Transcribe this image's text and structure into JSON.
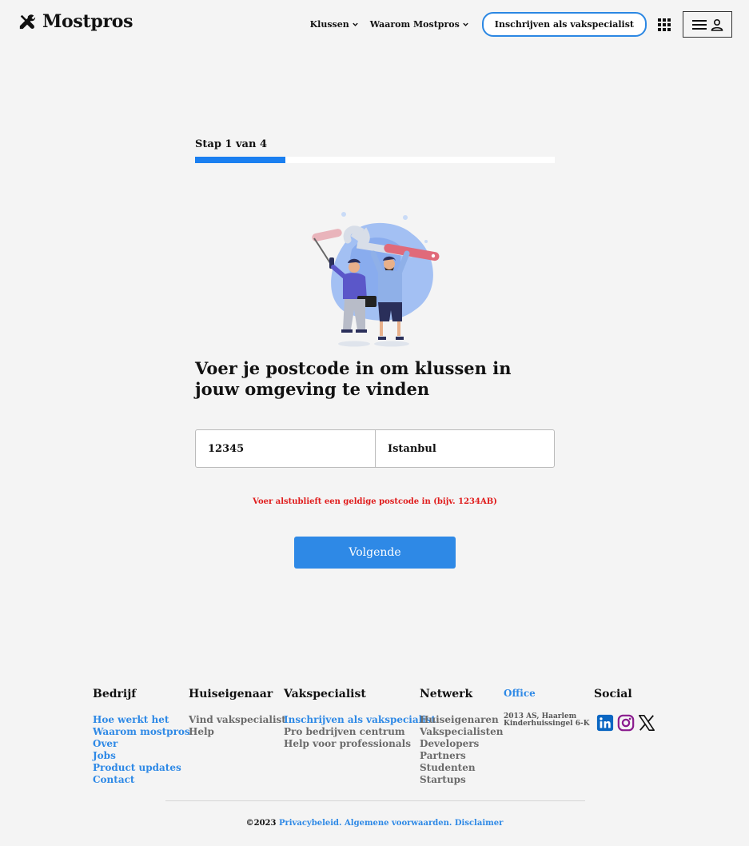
{
  "brand": {
    "name": "Mostpros",
    "logo_icon": "tools-icon"
  },
  "nav": {
    "items": [
      {
        "label": "Klussen"
      },
      {
        "label": "Waarom Mostpros"
      }
    ],
    "signup_label": "Inschrijven als vakspecialist"
  },
  "step": {
    "label": "Stap 1 van 4",
    "current": 1,
    "total": 4,
    "progress": 0.25
  },
  "heading": "Voer je postcode in om klussen in jouw omgeving te vinden",
  "form": {
    "postcode_value": "12345",
    "city_value": "Istanbul"
  },
  "error_text": "Voer alstublieft een geldige postcode in (bijv. 1234AB)",
  "next_label": "Volgende",
  "footer": {
    "bedrijf": {
      "title": "Bedrijf",
      "links": [
        "Hoe werkt het",
        "Waarom mostpros",
        "Over",
        "Jobs",
        "Product updates",
        "Contact"
      ]
    },
    "huiseigenaar": {
      "title": "Huiseigenaar",
      "links": [
        "Vind vakspecialist",
        "Help"
      ]
    },
    "vakspecialist": {
      "title": "Vakspecialist",
      "links": [
        "Inschrijven als vakspecialist",
        "Pro bedrijven centrum",
        "Help voor professionals"
      ]
    },
    "netwerk": {
      "title": "Netwerk",
      "links": [
        "Huiseigenaren",
        "Vakspecialisten",
        "Developers",
        "Partners",
        "Studenten",
        "Startups"
      ]
    },
    "office": {
      "title": "Office",
      "line1": "2013 AS, Haarlem",
      "line2": "Kinderhuissingel 6-K"
    },
    "social": {
      "title": "Social",
      "icons": [
        "linkedin-icon",
        "instagram-icon",
        "x-icon"
      ]
    },
    "copyright": "©2023",
    "legal_links": [
      "Privacybeleid.",
      "Algemene voorwaarden.",
      "Disclaimer"
    ]
  },
  "colors": {
    "accent": "#2e89e6",
    "progress": "#1a7ff0",
    "error": "#e01b1b",
    "background": "#f4f4f4"
  }
}
